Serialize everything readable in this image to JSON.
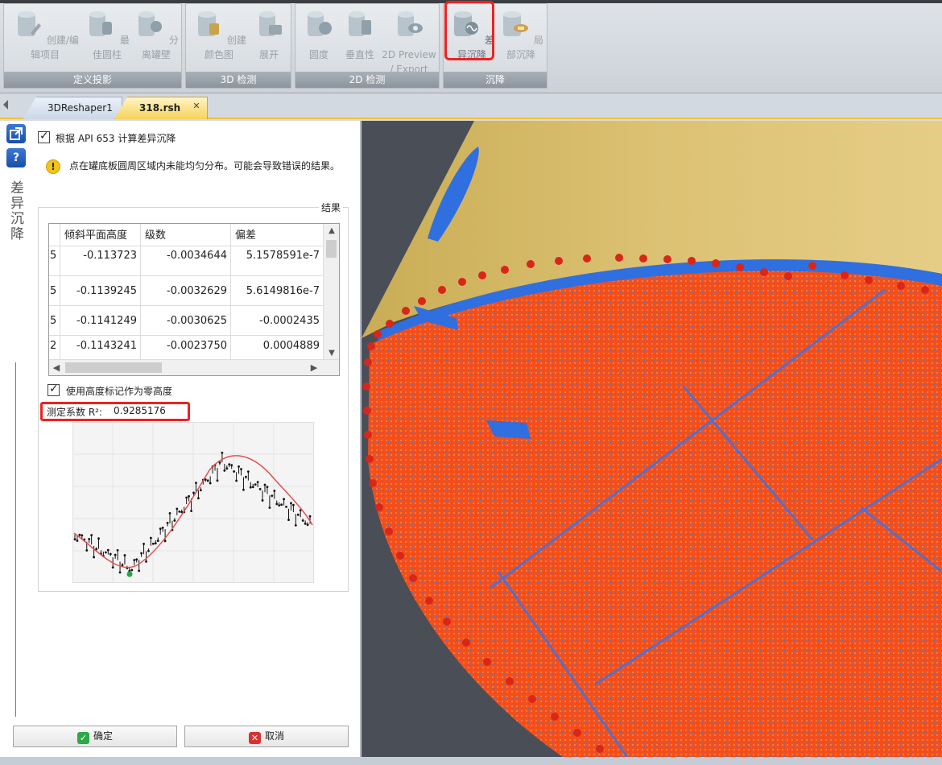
{
  "ribbon": {
    "groups": [
      {
        "label": "定义投影",
        "buttons": [
          "创建/编辑项目",
          "最佳圆柱",
          "分离罐壁"
        ]
      },
      {
        "label": "3D 检测",
        "buttons": [
          "创建颜色图",
          "展开"
        ]
      },
      {
        "label": "2D 检测",
        "buttons": [
          "圆度",
          "垂直性",
          "2D Preview",
          "/ Export"
        ]
      },
      {
        "label": "沉降",
        "buttons": [
          "差异沉降",
          "局部沉降"
        ]
      }
    ]
  },
  "tabs": [
    "3DReshaper1",
    "318.rsh"
  ],
  "tab_close": "✕",
  "panel": {
    "vertical_title": "差异沉降",
    "help_icon": "?",
    "api_checkbox_label": "根据 API 653 计算差异沉降",
    "warning_icon": "!",
    "warning_text": "点在罐底板圆周区域内未能均匀分布。可能会导致错误的结果。",
    "result_label": "结果",
    "table": {
      "headers": [
        "",
        "倾斜平面高度",
        "级数",
        "偏差"
      ],
      "rows": [
        [
          "5",
          "-0.113723",
          "-0.0034644",
          "5.1578591e-7"
        ],
        [
          "5",
          "-0.1139245",
          "-0.0032629",
          "5.6149816e-7"
        ],
        [
          "5",
          "-0.1141249",
          "-0.0030625",
          "-0.0002435"
        ],
        [
          "2",
          "-0.1143241",
          "-0.0023750",
          "0.0004889"
        ]
      ]
    },
    "zero_height_label": "使用高度标记作为零高度",
    "r2_label": "测定系数 R²:",
    "r2_value": "0.9285176",
    "ok_button": "确定",
    "cancel_button": "取消"
  },
  "scroll_arrows": {
    "up": "▲",
    "down": "▼",
    "left": "◀",
    "right": "▶"
  },
  "colors": {
    "highlight": "#e22222",
    "tab_active": "#f6d35a",
    "points": "#f04a1a",
    "blue": "#2f6fe0",
    "tank": "#d4b75c"
  }
}
